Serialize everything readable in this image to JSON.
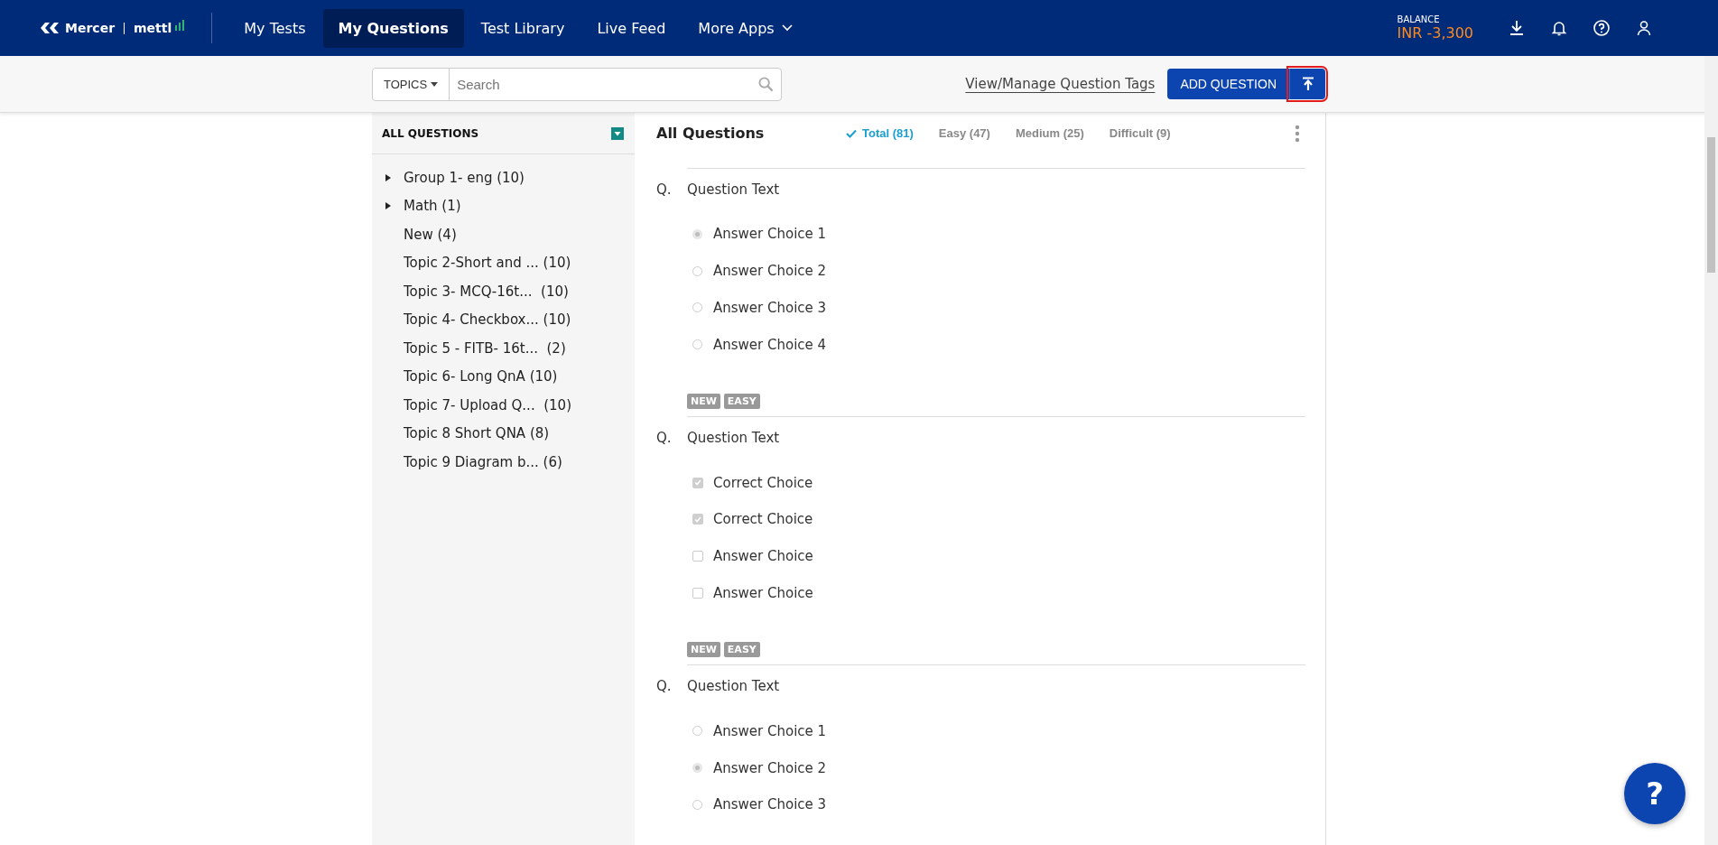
{
  "brand": {
    "company": "Mercer",
    "product": "mettl"
  },
  "nav": [
    {
      "label": "My Tests",
      "selected": false
    },
    {
      "label": "My Questions",
      "selected": true
    },
    {
      "label": "Test Library",
      "selected": false
    },
    {
      "label": "Live Feed",
      "selected": false
    },
    {
      "label": "More Apps",
      "selected": false,
      "dropdown": true
    }
  ],
  "balance": {
    "label": "BALANCE",
    "value": "INR -3,300"
  },
  "toolbar": {
    "topics": "TOPICS",
    "search": {
      "placeholder": "Search"
    },
    "tags_link": "View/Manage Question Tags",
    "add_button": "ADD QUESTION"
  },
  "sidebar": {
    "title": "ALL QUESTIONS",
    "items": [
      {
        "label": "Group 1- eng (10)",
        "expandable": true
      },
      {
        "label": "Math (1)",
        "expandable": true
      },
      {
        "label": "New (4)",
        "expandable": false
      },
      {
        "label": "Topic 2-Short and ... (10)",
        "expandable": false
      },
      {
        "label": "Topic 3- MCQ-16t...  (10)",
        "expandable": false
      },
      {
        "label": "Topic 4- Checkbox... (10)",
        "expandable": false
      },
      {
        "label": "Topic 5 - FITB- 16t...  (2)",
        "expandable": false
      },
      {
        "label": "Topic 6- Long QnA (10)",
        "expandable": false
      },
      {
        "label": "Topic 7- Upload Q...  (10)",
        "expandable": false
      },
      {
        "label": "Topic 8 Short QNA (8)",
        "expandable": false
      },
      {
        "label": "Topic 9 Diagram b... (6)",
        "expandable": false
      }
    ]
  },
  "content": {
    "title": "All Questions",
    "filters": [
      {
        "label": "Total (81)",
        "selected": true
      },
      {
        "label": "Easy (47)",
        "selected": false
      },
      {
        "label": "Medium (25)",
        "selected": false
      },
      {
        "label": "Difficult (9)",
        "selected": false
      }
    ],
    "questions": [
      {
        "prefix": "Q.",
        "text": "Question Text",
        "choices": [
          {
            "kind": "radio",
            "label": "Answer Choice 1",
            "checked": true
          },
          {
            "kind": "radio",
            "label": "Answer Choice 2",
            "checked": false
          },
          {
            "kind": "radio",
            "label": "Answer Choice 3",
            "checked": false
          },
          {
            "kind": "radio",
            "label": "Answer Choice 4",
            "checked": false
          }
        ]
      },
      {
        "badges": [
          "NEW",
          "EASY"
        ],
        "prefix": "Q.",
        "text": "Question Text",
        "choices": [
          {
            "kind": "checkbox",
            "label": "Correct Choice",
            "checked": true
          },
          {
            "kind": "checkbox",
            "label": "Correct Choice",
            "checked": true
          },
          {
            "kind": "checkbox",
            "label": "Answer Choice",
            "checked": false
          },
          {
            "kind": "checkbox",
            "label": "Answer Choice",
            "checked": false
          }
        ]
      },
      {
        "badges": [
          "NEW",
          "EASY"
        ],
        "prefix": "Q.",
        "text": "Question Text",
        "choices": [
          {
            "kind": "radio",
            "label": "Answer Choice 1",
            "checked": false
          },
          {
            "kind": "radio",
            "label": "Answer Choice 2",
            "checked": true
          },
          {
            "kind": "radio",
            "label": "Answer Choice 3",
            "checked": false
          }
        ]
      }
    ]
  },
  "help_button": "?"
}
